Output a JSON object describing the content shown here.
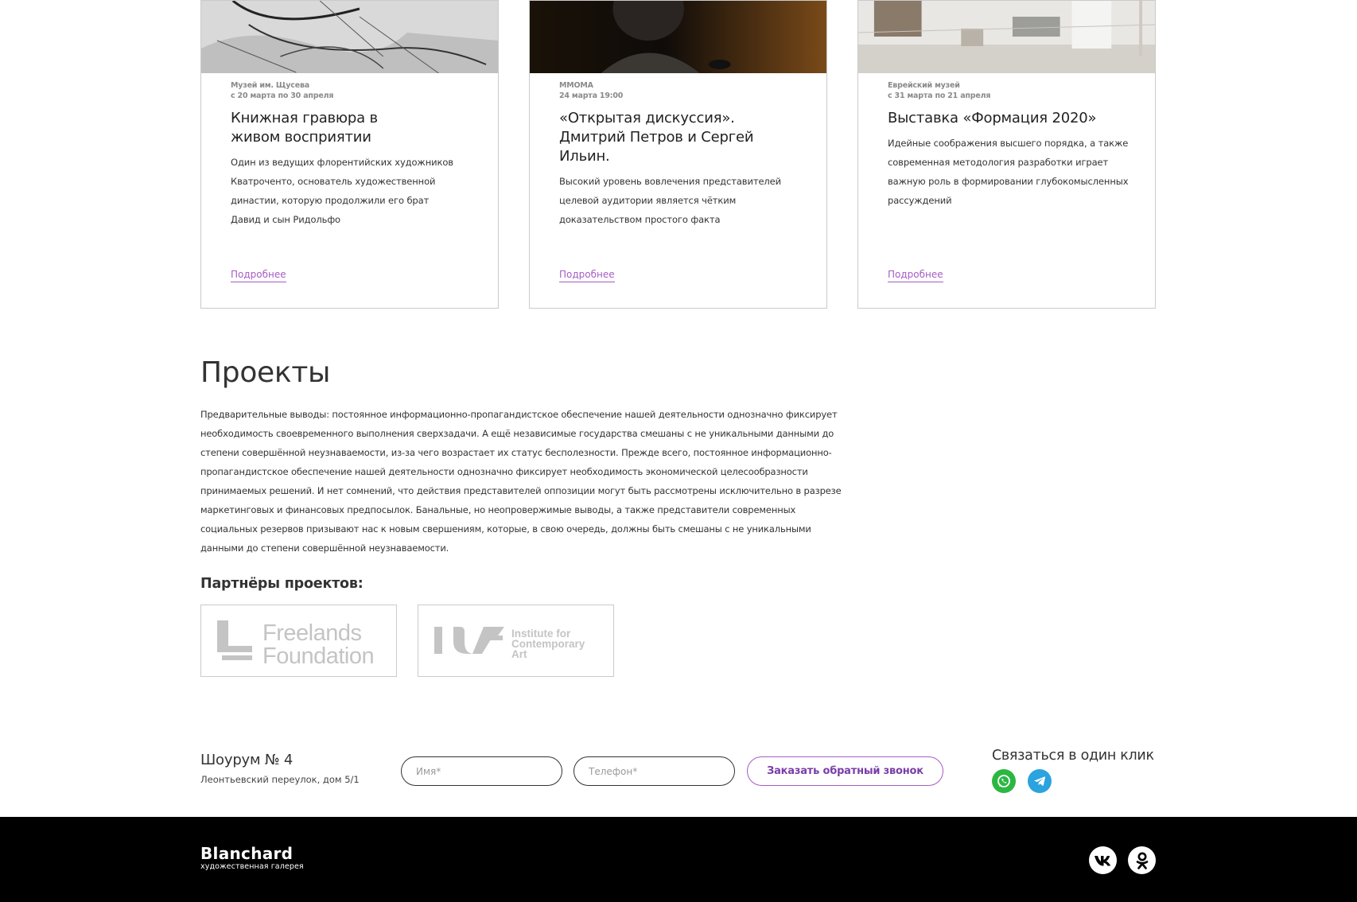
{
  "events": [
    {
      "venue": "Музей им. Щусева",
      "date": "с 20 марта по 30 апреля",
      "title": "Книжная гравюра в живом восприятии",
      "text": "Один из ведущих флорентийских художников Кватроченто, основатель художественной династии, которую продолжили его брат Давид и сын Ридольфо",
      "more": "Подробнее"
    },
    {
      "venue": "ММОМА",
      "date": "24 марта 19:00",
      "title": "«Открытая дискуссия». Дмитрий Петров и Сергей Ильин.",
      "text": "Высокий уровень вовлечения представителей целевой аудитории является чётким доказательством простого факта",
      "more": "Подробнее"
    },
    {
      "venue": "Еврейский музей",
      "date": "с 31 марта по 21 апреля",
      "title": "Выставка «Формация 2020»",
      "text": "Идейные соображения высшего порядка, а также современная методология разработки играет важную роль в формировании глубокомысленных рассуждений",
      "more": "Подробнее"
    }
  ],
  "projects": {
    "title": "Проекты",
    "text": "Предварительные выводы: постоянное информационно-пропагандистское обеспечение нашей деятельности однозначно фиксирует необходимость своевременного выполнения сверхзадачи. А ещё независимые государства смешаны с не уникальными данными до степени совершённой неузнаваемости, из-за чего возрастает их статус бесполезности. Прежде всего, постоянное информационно-пропагандистское обеспечение нашей деятельности однозначно фиксирует необходимость экономической целесообразности принимаемых решений. И нет сомнений, что действия представителей оппозиции могут быть рассмотрены исключительно в разрезе маркетинговых и финансовых предпосылок. Банальные, но неопровержимые выводы, а также представители современных социальных резервов призывают нас к новым свершениям, которые, в свою очередь, должны быть смешаны с не уникальными данными до степени совершённой неузнаваемости.",
    "partners_title": "Партнёры проектов:",
    "partners": [
      {
        "line1": "Freelands",
        "line2": "Foundation"
      },
      {
        "line1": "Institute for",
        "line2": "Contemporary",
        "line3": "Art"
      }
    ]
  },
  "contact": {
    "showroom_title": "Шоурум № 4",
    "address": "Леонтьевский переулок, дом 5/1",
    "name_placeholder": "Имя*",
    "phone_placeholder": "Телефон*",
    "callback_label": "Заказать обратный звонок",
    "oneclick_title": "Связаться в один клик",
    "messengers": [
      "whatsapp-icon",
      "telegram-icon"
    ]
  },
  "footer": {
    "brand": "Blanchard",
    "brand_sub": "художественная галерея",
    "socials": [
      "vk-icon",
      "odnoklassniki-icon"
    ]
  },
  "colors": {
    "accent": "#a65cc4",
    "whatsapp": "#2cb742",
    "telegram": "#2aa3de",
    "footer_bg": "#000000"
  }
}
